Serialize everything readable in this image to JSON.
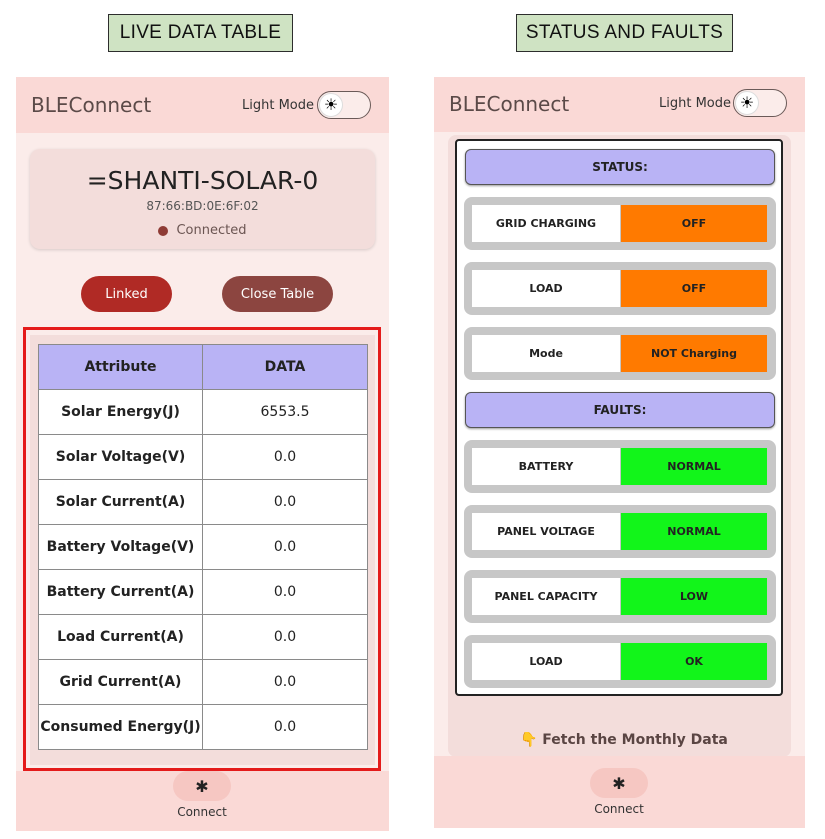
{
  "captions": {
    "left": "LIVE DATA TABLE",
    "right": "STATUS AND FAULTS"
  },
  "app": {
    "name": "BLEConnect",
    "light_mode_label": "Light Mode"
  },
  "device": {
    "name": "=SHANTI-SOLAR-0",
    "mac": "87:66:BD:0E:6F:02",
    "status": "Connected"
  },
  "buttons": {
    "linked": "Linked",
    "close_table": "Close Table"
  },
  "live_table": {
    "headers": [
      "Attribute",
      "DATA"
    ],
    "rows": [
      [
        "Solar Energy(J)",
        "6553.5"
      ],
      [
        "Solar Voltage(V)",
        "0.0"
      ],
      [
        "Solar Current(A)",
        "0.0"
      ],
      [
        "Battery Voltage(V)",
        "0.0"
      ],
      [
        "Battery Current(A)",
        "0.0"
      ],
      [
        "Load Current(A)",
        "0.0"
      ],
      [
        "Grid Current(A)",
        "0.0"
      ],
      [
        "Consumed Energy(J)",
        "0.0"
      ]
    ]
  },
  "status": {
    "header": "STATUS:",
    "rows": [
      {
        "label": "GRID CHARGING",
        "value": "OFF",
        "color": "#ff7a00"
      },
      {
        "label": "LOAD",
        "value": "OFF",
        "color": "#ff7a00"
      },
      {
        "label": "Mode",
        "value": "NOT Charging",
        "color": "#ff7a00"
      }
    ]
  },
  "faults": {
    "header": "FAULTS:",
    "rows": [
      {
        "label": "BATTERY",
        "value": "NORMAL",
        "color": "#12f51a"
      },
      {
        "label": "PANEL VOLTAGE",
        "value": "NORMAL",
        "color": "#12f51a"
      },
      {
        "label": "PANEL CAPACITY",
        "value": "LOW",
        "color": "#12f51a"
      },
      {
        "label": "LOAD",
        "value": "OK",
        "color": "#12f51a"
      }
    ]
  },
  "fetch_monthly": "👇 Fetch the Monthly Data",
  "bottom_nav": {
    "connect_label": "Connect",
    "icon": "bluetooth-icon"
  },
  "icons": {
    "theme": "sun-icon"
  }
}
